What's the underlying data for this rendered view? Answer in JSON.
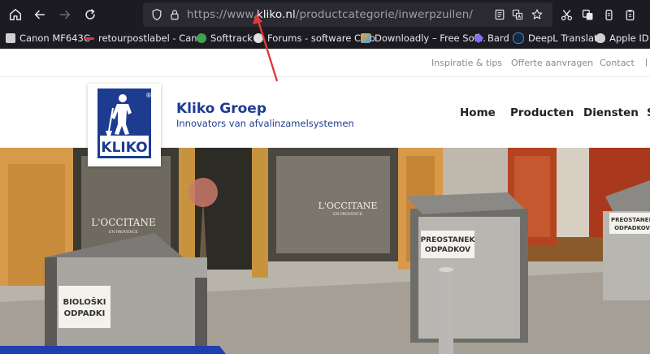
{
  "browser": {
    "url_prefix": "https://www.",
    "url_domain": "kliko.nl",
    "url_path": "/productcategorie/inwerpzuilen/"
  },
  "bookmarks": [
    {
      "label": "Canon MF643C",
      "color": "#d0d0d0"
    },
    {
      "label": "retourpostlabel - Can...",
      "color": "#e0383e"
    },
    {
      "label": "Softtrack",
      "color": "#3fa34d"
    },
    {
      "label": "Forums - software Club",
      "color": "#e0e0e0"
    },
    {
      "label": "Downloadly – Free Sof...",
      "color": "#f6a623"
    },
    {
      "label": "Bard",
      "color": "#8a6cf0"
    },
    {
      "label": "DeepL Translate",
      "color": "#0f2b46"
    },
    {
      "label": "Apple ID",
      "color": "#d0d0d0"
    }
  ],
  "toplinks": [
    "Inspiratie & tips",
    "Offerte aanvragen",
    "Contact"
  ],
  "brand": {
    "name": "Kliko Groep",
    "tagline": "Innovators van afvalinzamelsystemen",
    "logo_text": "KLIKO",
    "logo_reg": "®"
  },
  "nav": [
    "Home",
    "Producten",
    "Diensten"
  ],
  "hero": {
    "signs": [
      "L'OCCITANE",
      "EN PROVENCE",
      "L'OCCITANE",
      "EN PROVENCE"
    ],
    "bin_labels": [
      "PREOSTANEK",
      "ODPADKOV",
      "BIOLOŠKI",
      "ODPADKI",
      "PREOSTANEK",
      "ODPADKOV"
    ]
  },
  "colors": {
    "toolbar_bg": "#1c1b22",
    "urlbar_bg": "#2b2a33",
    "brand_blue": "#1d3c8f",
    "annotation_arrow": "#e23b3b"
  }
}
